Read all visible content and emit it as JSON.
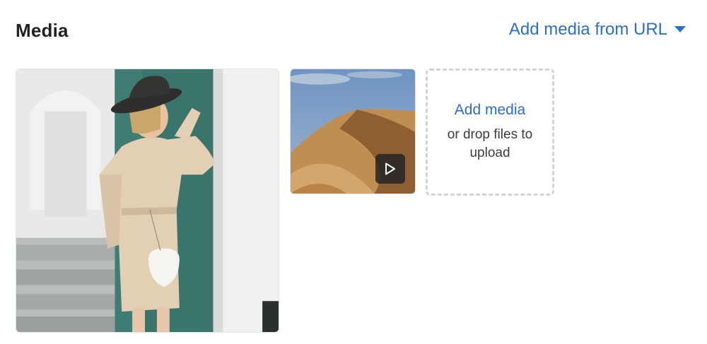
{
  "section": {
    "title": "Media",
    "add_from_url_label": "Add media from URL"
  },
  "media": [
    {
      "type": "image",
      "icon": "photo-thumbnail"
    },
    {
      "type": "video",
      "icon": "play-icon"
    }
  ],
  "dropzone": {
    "title": "Add media",
    "hint": "or drop files to upload"
  },
  "colors": {
    "accent": "#2c6ecb",
    "heading": "#202223",
    "dashed_border": "#d2d5d8"
  }
}
